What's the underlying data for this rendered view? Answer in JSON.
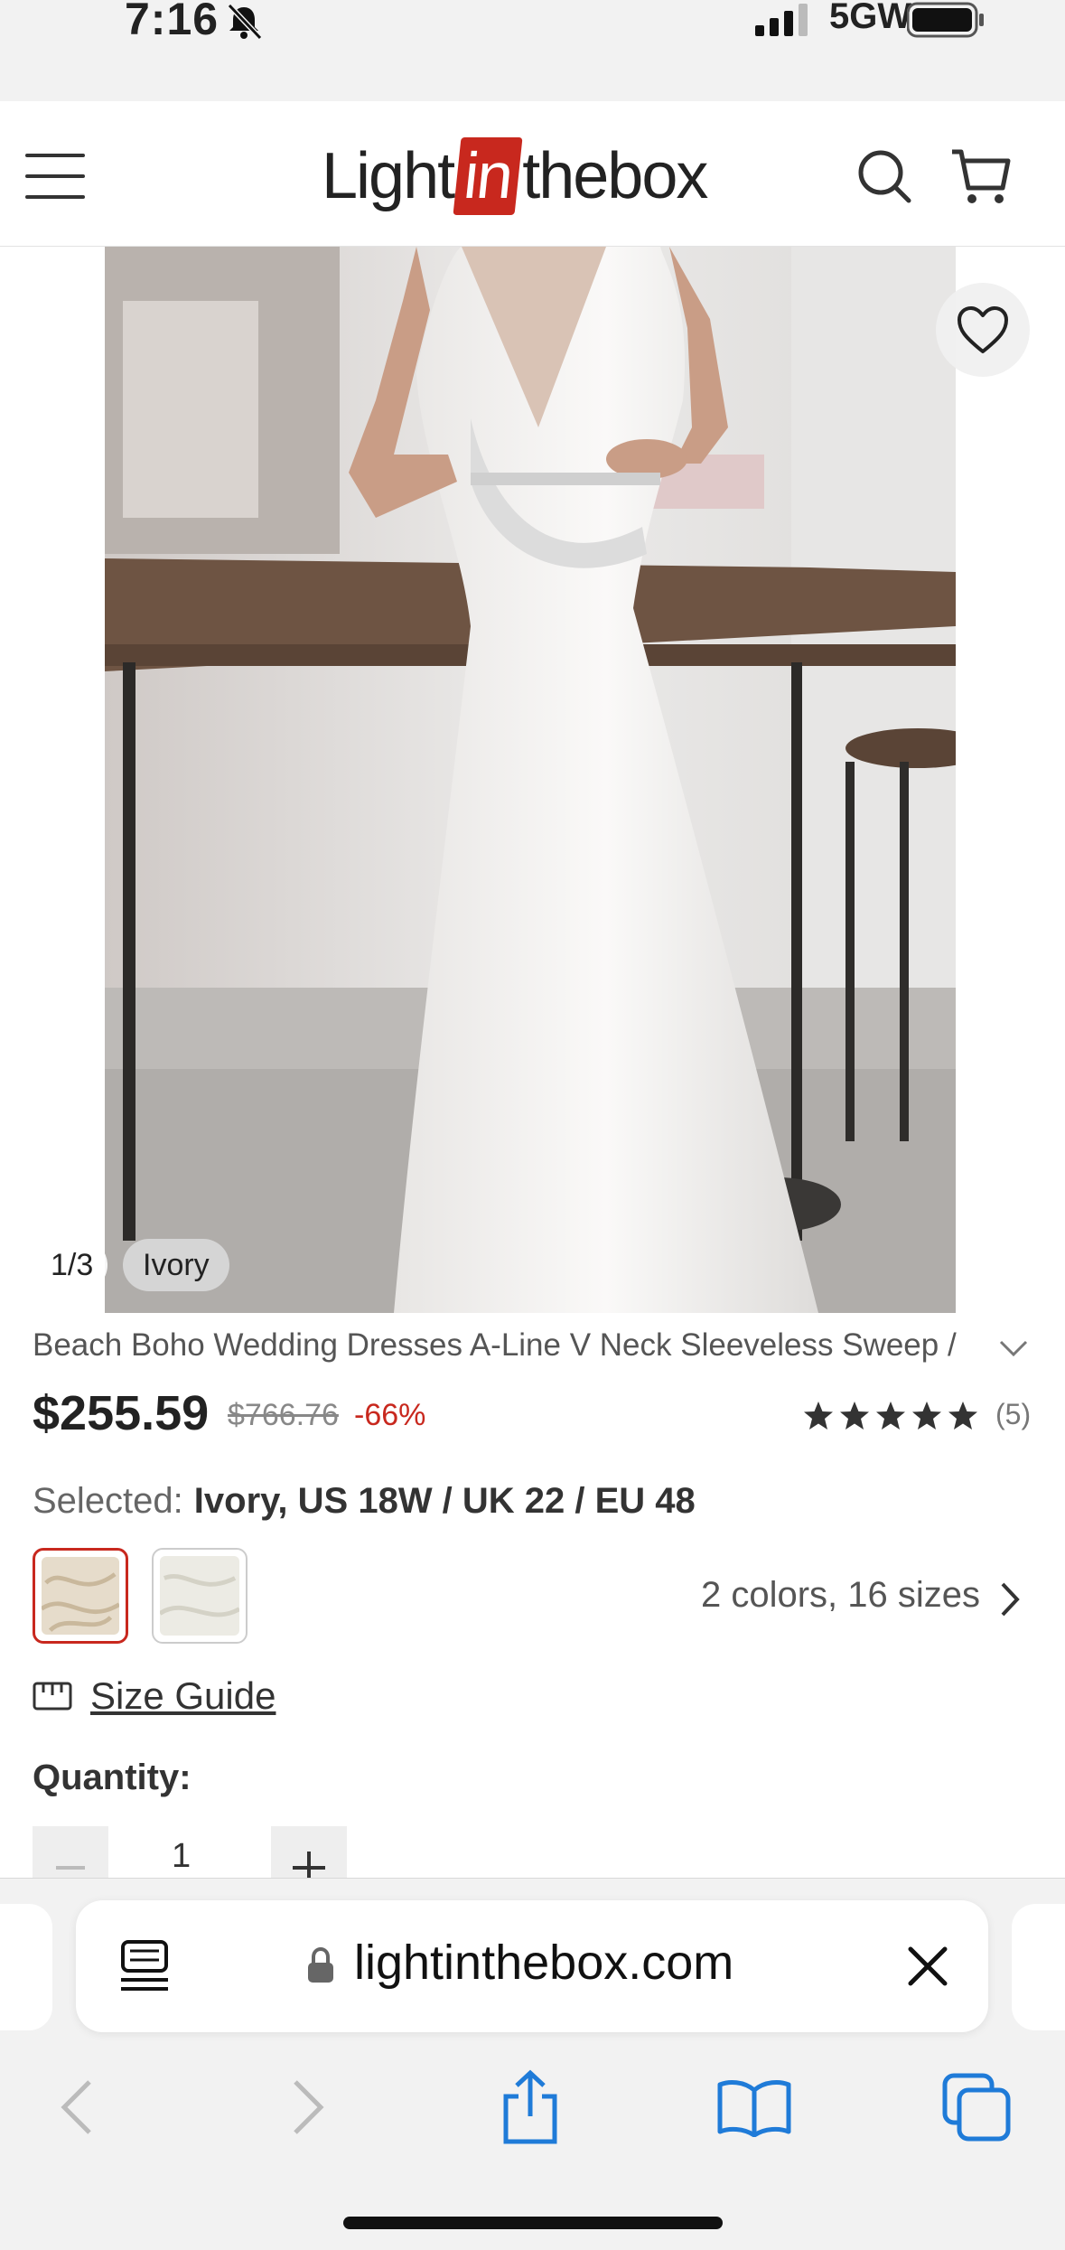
{
  "status_bar": {
    "time": "7:16",
    "network": "5GW"
  },
  "site": {
    "logo_pre": "Light",
    "logo_in": "in",
    "logo_post": "thebox",
    "brand_color": "#c8281e"
  },
  "gallery": {
    "counter": "1/3",
    "color_chip": "Ivory"
  },
  "product": {
    "title": "Beach Boho Wedding Dresses A-Line V Neck Sleeveless Sweep /",
    "price": "$255.59",
    "original_price": "$766.76",
    "discount": "-66%",
    "rating": 5,
    "review_count": "(5)",
    "selected_label": "Selected:",
    "selected_value": "Ivory, US 18W / UK 22 / EU 48",
    "options_summary": "2 colors, 16 sizes",
    "size_guide": "Size Guide",
    "quantity_label": "Quantity:",
    "quantity": "1"
  },
  "browser": {
    "url": "lightinthebox.com"
  }
}
